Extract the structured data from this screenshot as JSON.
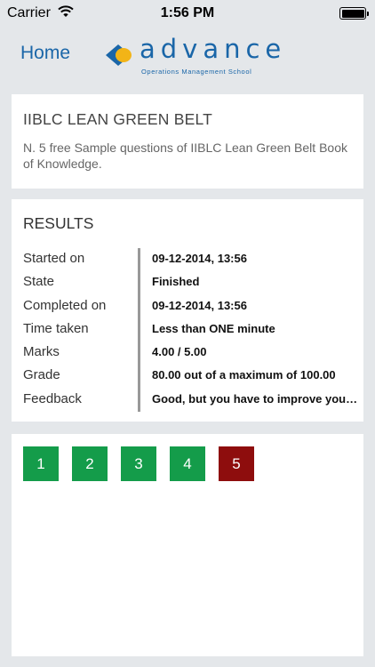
{
  "status_bar": {
    "carrier": "Carrier",
    "time": "1:56 PM"
  },
  "nav": {
    "home_label": "Home",
    "logo_word": "advance",
    "logo_subtitle": "Operations Management School"
  },
  "course": {
    "title": "IIBLC LEAN GREEN BELT",
    "description": "N. 5 free Sample questions of IIBLC Lean Green Belt Book of Knowledge."
  },
  "results": {
    "title": "RESULTS",
    "rows": [
      {
        "label": "Started on",
        "value": "09-12-2014, 13:56"
      },
      {
        "label": "State",
        "value": "Finished"
      },
      {
        "label": "Completed on",
        "value": "09-12-2014, 13:56"
      },
      {
        "label": "Time taken",
        "value": "Less than ONE minute"
      },
      {
        "label": "Marks",
        "value": "4.00 / 5.00"
      },
      {
        "label": "Grade",
        "value": "80.00 out of a maximum of 100.00"
      },
      {
        "label": "Feedback",
        "value": "Good, but you have to improve you…"
      }
    ]
  },
  "question_nav": {
    "buttons": [
      {
        "label": "1",
        "status": "correct",
        "color": "#149c4a"
      },
      {
        "label": "2",
        "status": "correct",
        "color": "#149c4a"
      },
      {
        "label": "3",
        "status": "correct",
        "color": "#149c4a"
      },
      {
        "label": "4",
        "status": "correct",
        "color": "#149c4a"
      },
      {
        "label": "5",
        "status": "incorrect",
        "color": "#8e0d0d"
      }
    ]
  },
  "colors": {
    "brand_blue": "#1a66a8",
    "logo_yellow": "#f2b417",
    "background": "#e4e7ea"
  }
}
